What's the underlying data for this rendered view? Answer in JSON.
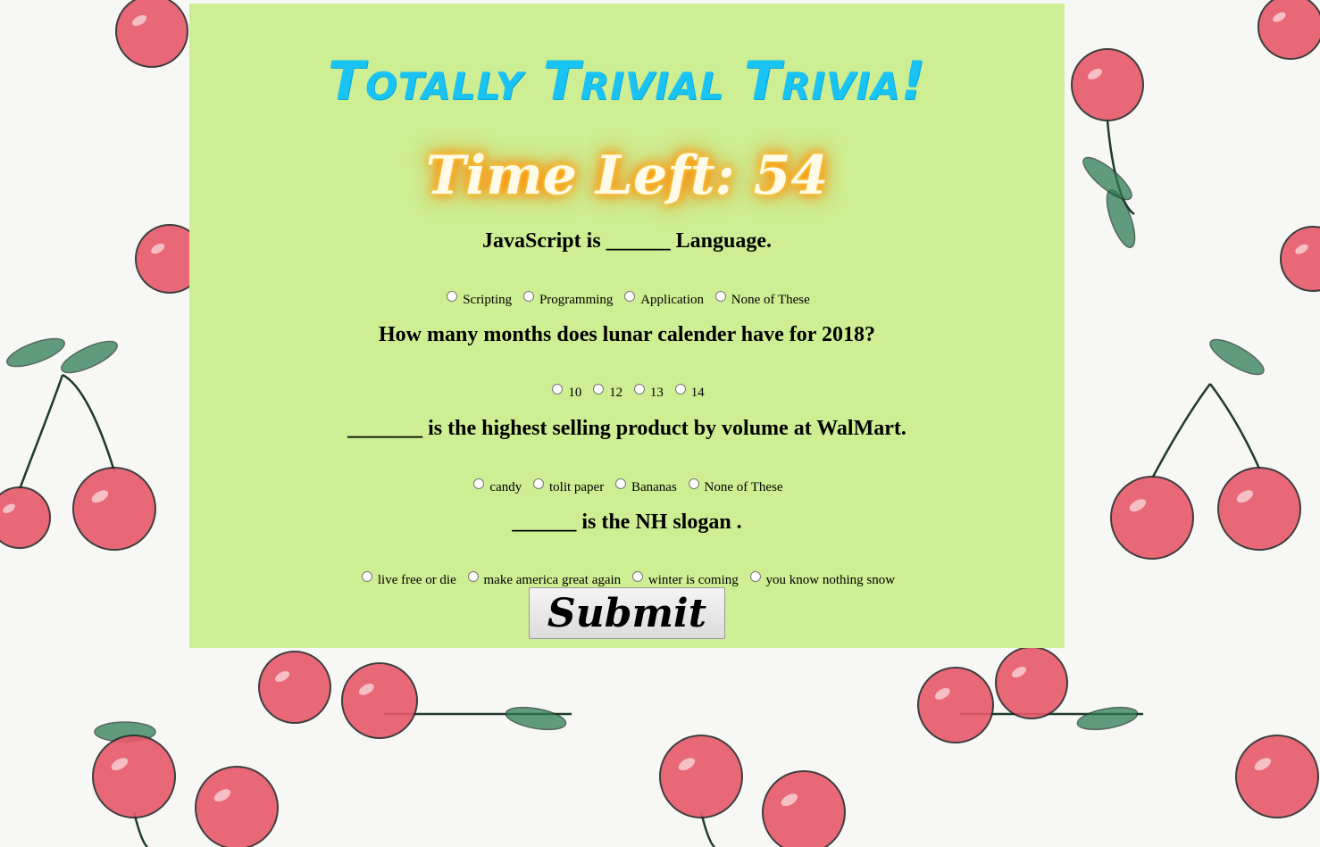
{
  "title": "Totally Trivial Trivia!",
  "timer": "Time Left: 54",
  "questions": [
    {
      "text": "JavaScript is ______ Language.",
      "options": [
        "Scripting",
        "Programming",
        "Application",
        "None of These"
      ]
    },
    {
      "text": "How many months does lunar calender have for 2018?",
      "options": [
        "10",
        "12",
        "13",
        "14"
      ]
    },
    {
      "text": "_______ is the highest selling product by volume at WalMart.",
      "options": [
        "candy",
        "tolit paper",
        "Bananas",
        "None of These"
      ]
    },
    {
      "text": "______ is the NH slogan .",
      "options": [
        "live free or die",
        "make america great again",
        "winter is coming",
        "you know nothing snow"
      ]
    }
  ],
  "submit_label": "Submit",
  "colors": {
    "card_bg": "#cdee92",
    "title": "#19c3f4",
    "timer_glow": "#ff8c00",
    "cherry": "#e8596b",
    "stem": "#2e7d55"
  }
}
